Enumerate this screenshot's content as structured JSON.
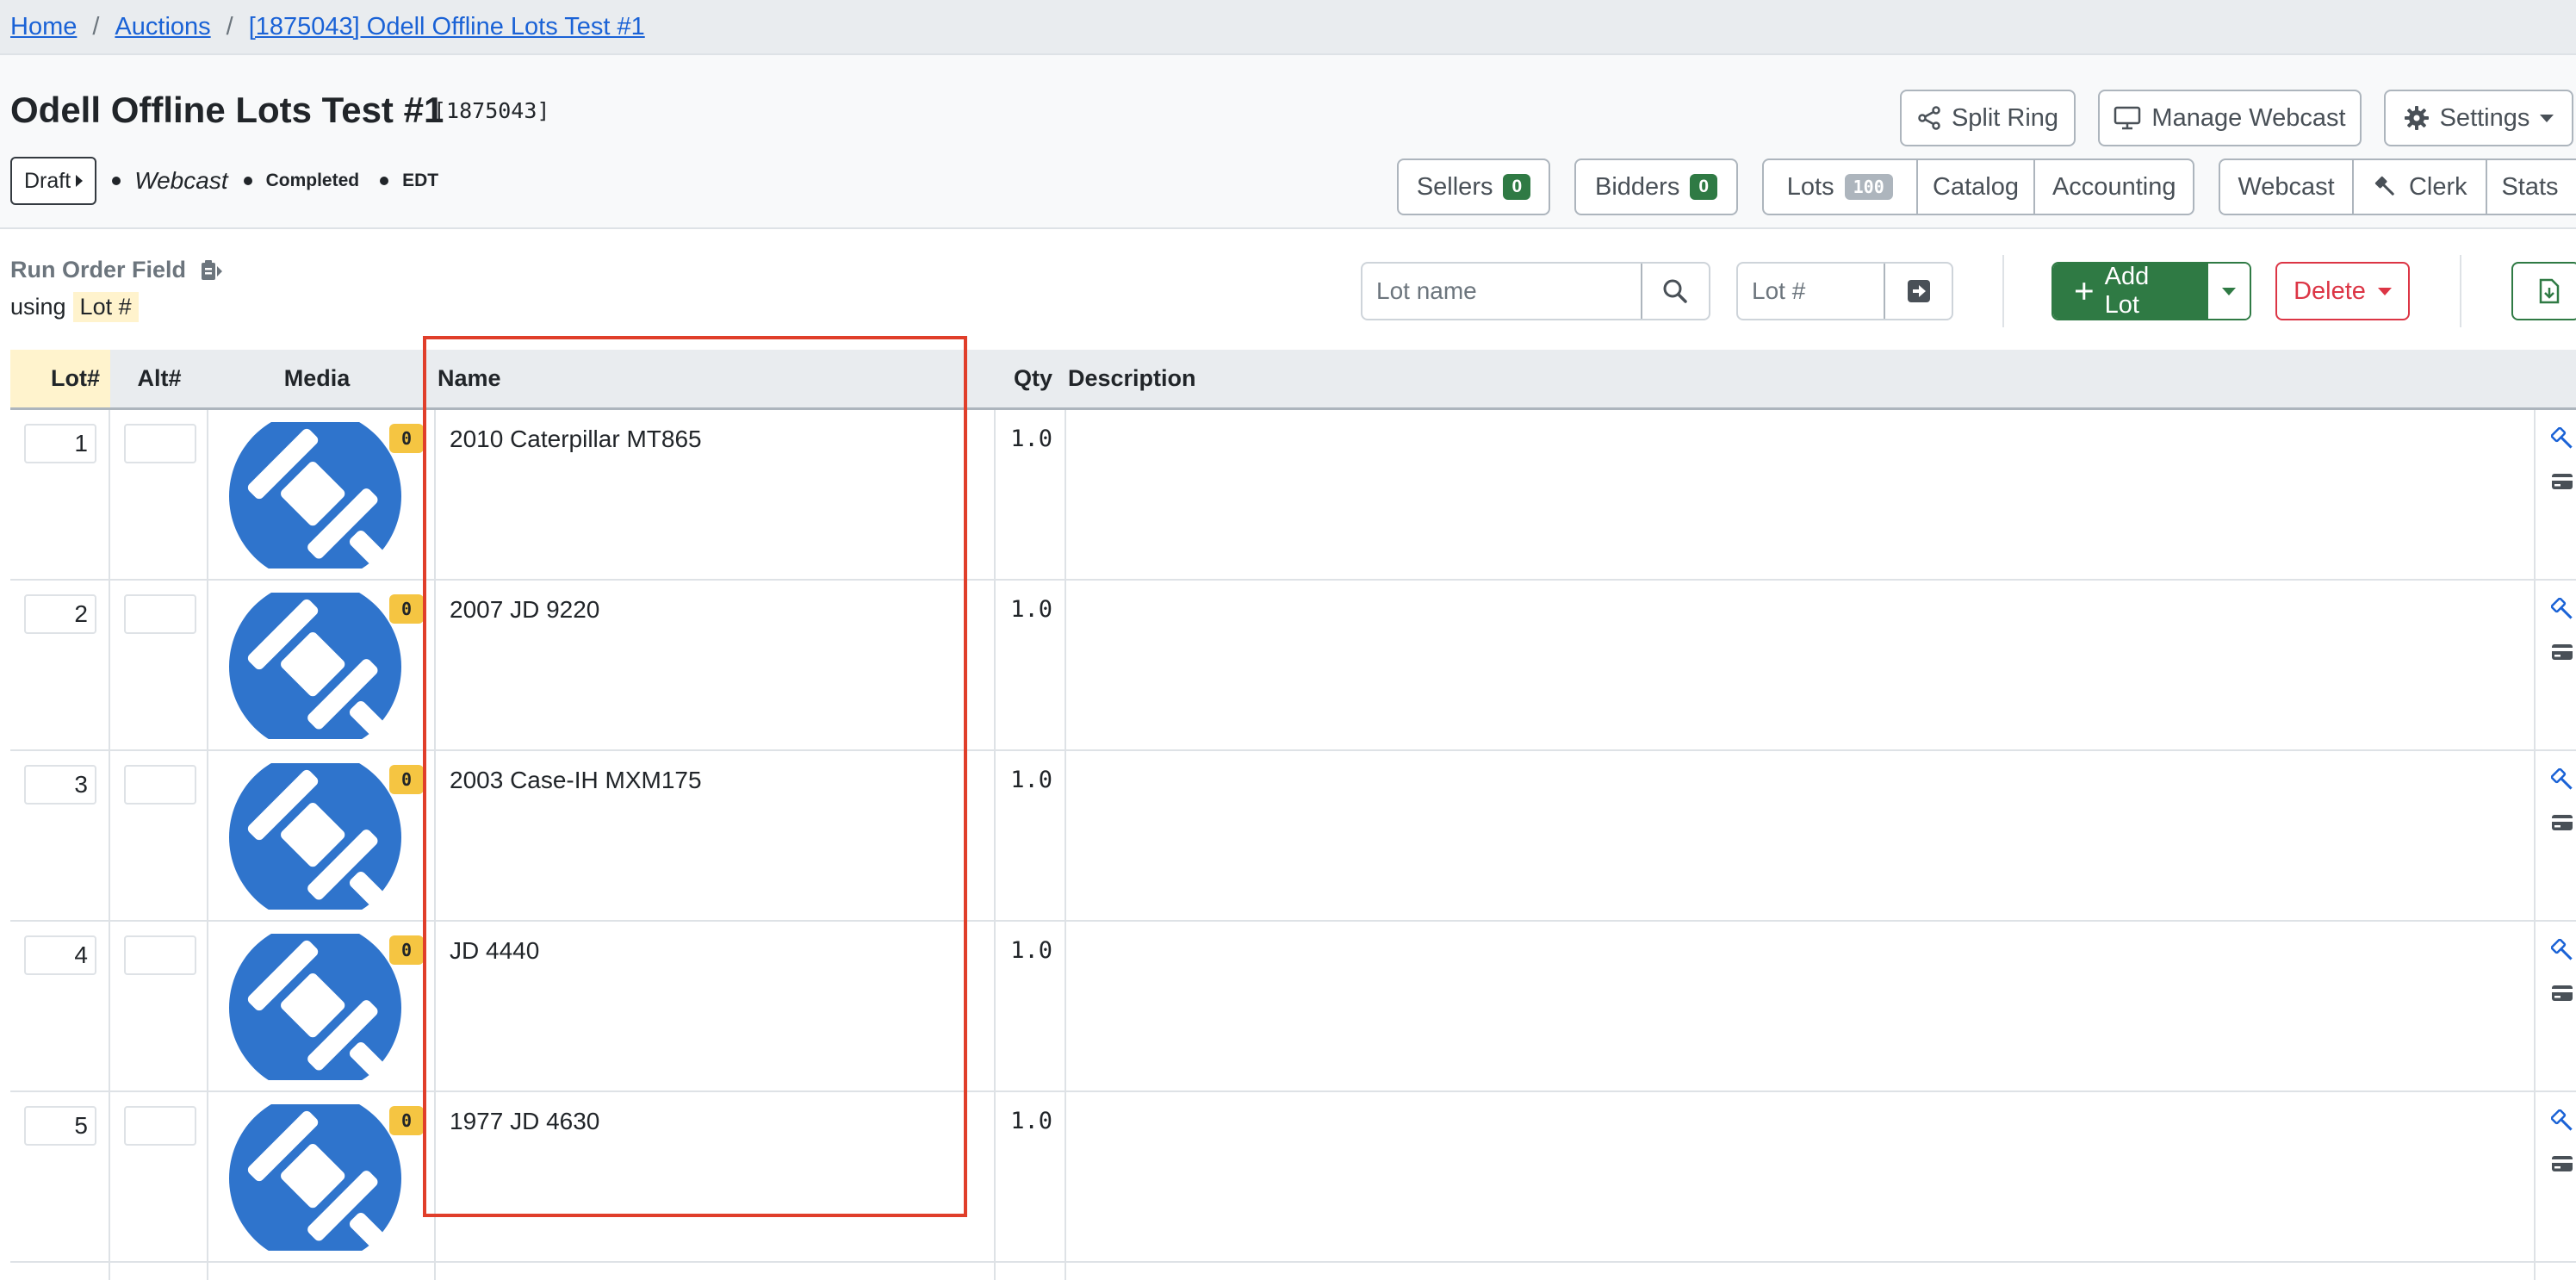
{
  "breadcrumb": {
    "home": "Home",
    "auctions": "Auctions",
    "current": "[1875043] Odell Offline Lots Test #1",
    "separator": "/"
  },
  "header": {
    "title": "Odell Offline Lots Test #1",
    "auction_id": "[1875043]",
    "status_button": "Draft",
    "status_type": "Webcast",
    "status_state": "Completed",
    "timezone": "EDT"
  },
  "actions": {
    "split_ring": "Split Ring",
    "manage_webcast": "Manage Webcast",
    "settings": "Settings"
  },
  "nav": {
    "sellers": "Sellers",
    "sellers_count": "0",
    "bidders": "Bidders",
    "bidders_count": "0",
    "lots": "Lots",
    "lots_count": "100",
    "catalog": "Catalog",
    "accounting": "Accounting",
    "webcast": "Webcast",
    "clerk": "Clerk",
    "stats": "Stats"
  },
  "toolbar": {
    "run_order_label": "Run Order Field",
    "using_label": "using",
    "using_value": "Lot #",
    "lot_name_placeholder": "Lot name",
    "lot_number_placeholder": "Lot #",
    "add_lot": "Add Lot",
    "delete": "Delete"
  },
  "table": {
    "columns": {
      "lot": "Lot#",
      "alt": "Alt#",
      "media": "Media",
      "name": "Name",
      "qty": "Qty",
      "description": "Description"
    },
    "rows": [
      {
        "lot": "1",
        "name": "2010 Caterpillar MT865",
        "qty": "1.0",
        "media_count": "0"
      },
      {
        "lot": "2",
        "name": "2007 JD 9220",
        "qty": "1.0",
        "media_count": "0"
      },
      {
        "lot": "3",
        "name": "2003 Case-IH MXM175",
        "qty": "1.0",
        "media_count": "0"
      },
      {
        "lot": "4",
        "name": "JD 4440",
        "qty": "1.0",
        "media_count": "0"
      },
      {
        "lot": "5",
        "name": "1977 JD 4630",
        "qty": "1.0",
        "media_count": "0"
      }
    ]
  },
  "colors": {
    "link": "#1a62d6",
    "brand_green": "#2f7a44",
    "danger": "#dc3545",
    "media_blue": "#2f74cc",
    "highlight_box": "#e03e2a",
    "badge_yellow": "#f5c542"
  }
}
